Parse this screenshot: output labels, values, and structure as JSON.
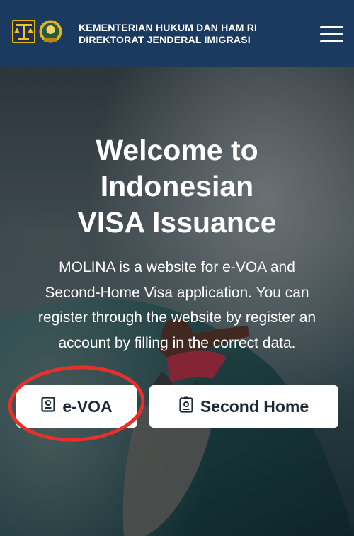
{
  "header": {
    "title_line1": "KEMENTERIAN HUKUM DAN HAM RI",
    "title_line2": "DIREKTORAT JENDERAL IMIGRASI",
    "logo_icons": [
      "ministry-emblem-icon",
      "immigration-emblem-icon"
    ],
    "menu_icon": "hamburger-menu-icon",
    "background_color": "#1a3a5f"
  },
  "hero": {
    "title_line1": "Welcome to",
    "title_line2": "Indonesian",
    "title_line3": "VISA Issuance",
    "desc_line1": "MOLINA is a website for e-VOA and",
    "desc_line2": "Second-Home Visa application. You can",
    "desc_line3": "register through the website by register an",
    "desc_line4": "account by filling in the correct data.",
    "background_description_icon": "surfer-background-image"
  },
  "buttons": {
    "evoa_label": "e-VOA",
    "second_home_label": "Second Home",
    "evoa_icon": "id-card-icon",
    "second_home_icon": "id-badge-icon"
  },
  "annotation": {
    "highlight_color": "#e8302a"
  }
}
